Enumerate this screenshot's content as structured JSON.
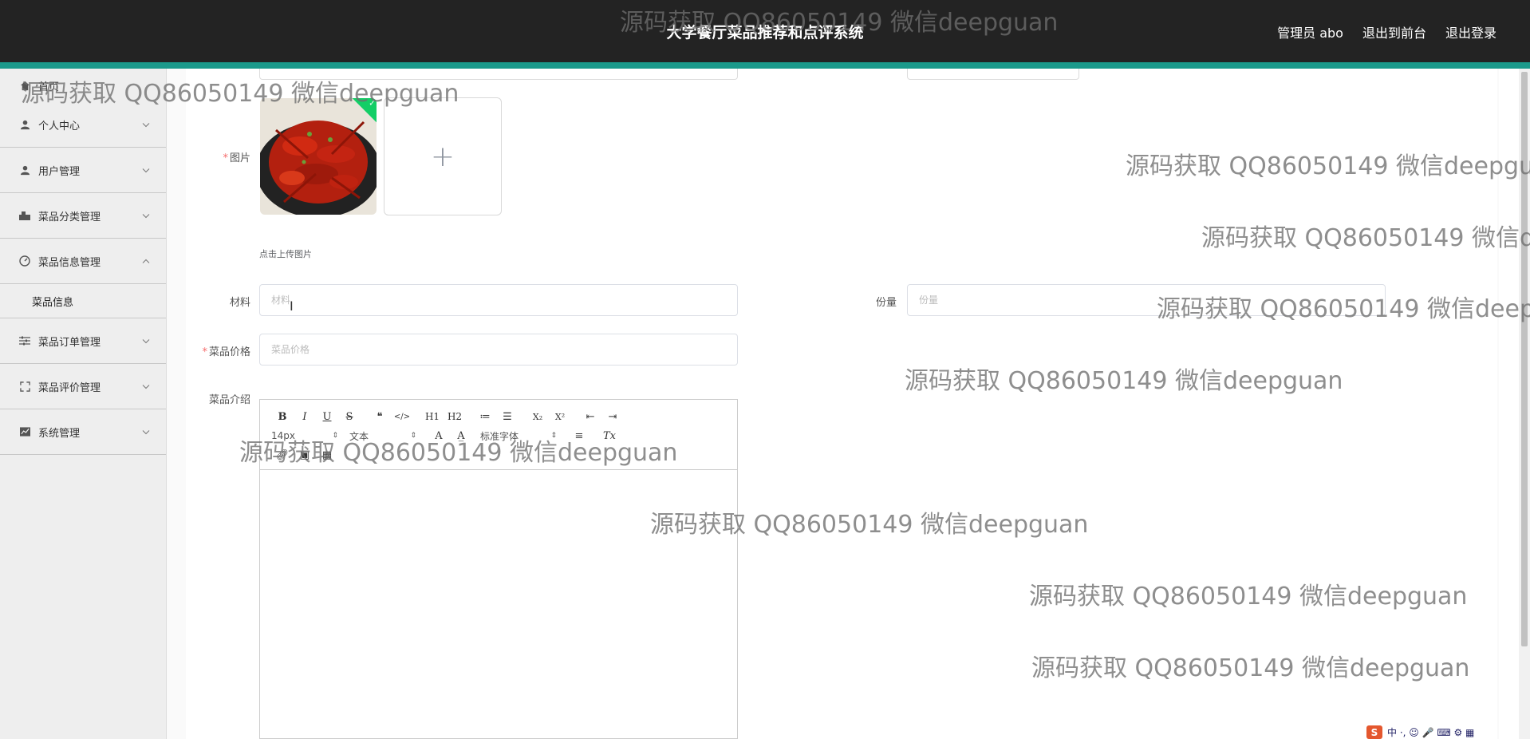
{
  "header": {
    "title": "大学餐厅菜品推荐和点评系统",
    "links": [
      "管理员 abo",
      "退出到前台",
      "退出登录"
    ]
  },
  "sidebar": {
    "items": [
      {
        "label": "首页",
        "icon": "home-icon"
      },
      {
        "label": "个人中心",
        "icon": "user-icon"
      },
      {
        "label": "用户管理",
        "icon": "user-icon"
      },
      {
        "label": "菜品分类管理",
        "icon": "category-icon"
      },
      {
        "label": "菜品信息管理",
        "icon": "dashboard-icon",
        "expanded": true
      },
      {
        "label": "菜品信息",
        "sub": true
      },
      {
        "label": "菜品订单管理",
        "icon": "sliders-icon"
      },
      {
        "label": "菜品评价管理",
        "icon": "fullscreen-icon"
      },
      {
        "label": "系统管理",
        "icon": "chart-icon"
      }
    ]
  },
  "form": {
    "image_label": "图片",
    "upload_tip": "点击上传图片",
    "material_label": "材料",
    "material_placeholder": "材料",
    "portion_label": "份量",
    "portion_placeholder": "份量",
    "price_label": "菜品价格",
    "price_placeholder": "菜品价格",
    "intro_label": "菜品介绍",
    "required_mark": "*"
  },
  "editor": {
    "font_size": "14px",
    "text_style": "文本",
    "font_family": "标准字体",
    "buttons_row1": [
      "B",
      "I",
      "U",
      "S",
      "❝",
      "</>",
      "H1",
      "H2",
      "≔",
      "☰",
      "X₂",
      "X²",
      "⇤",
      "⇥"
    ],
    "buttons_row2_icons": [
      "A",
      "A̲",
      "≡",
      "Tx"
    ],
    "buttons_row3_icons": [
      "link-icon",
      "image-icon",
      "video-icon"
    ]
  },
  "watermark_text": "源码获取 QQ86050149 微信deepguan",
  "ime": {
    "logo": "S",
    "text": "中 ·, ☺ 🎤 ⌨ ⚙ ▦"
  },
  "colors": {
    "header_bg": "#232323",
    "accent": "#1b9a8b",
    "required": "#f56c6c"
  }
}
